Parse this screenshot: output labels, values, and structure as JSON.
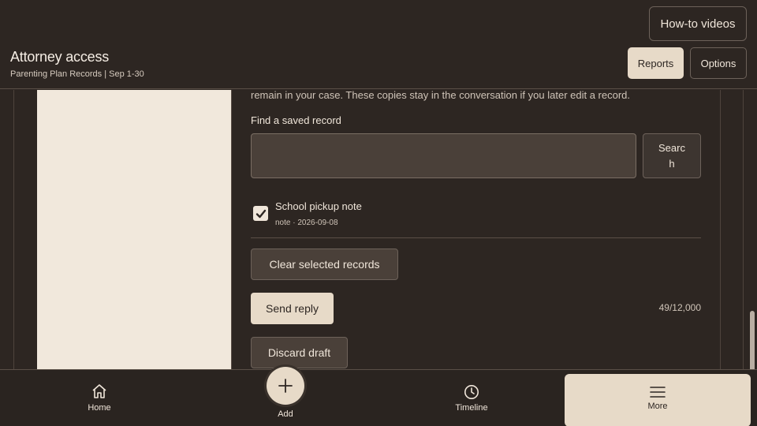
{
  "header": {
    "title": "Attorney access",
    "subtitle": "Parenting Plan Records | Sep 1-30",
    "how_to_label": "How-to videos",
    "reports_label": "Reports",
    "options_label": "Options"
  },
  "main": {
    "intro_text": "remain in your case. These copies stay in the conversation if you later edit a record.",
    "find_label": "Find a saved record",
    "search_value": "",
    "search_placeholder": "",
    "search_button": "Search",
    "record": {
      "title": "School pickup note",
      "meta": "note · 2026-09-08",
      "checked": true
    },
    "clear_button": "Clear selected records",
    "send_button": "Send reply",
    "char_count": "49/12,000",
    "discard_button": "Discard draft"
  },
  "nav": {
    "home": "Home",
    "add": "Add",
    "timeline": "Timeline",
    "more": "More"
  },
  "colors": {
    "background": "#2d2622",
    "accent": "#e7dac8",
    "panel": "#f1e8dc"
  },
  "icons": {
    "home": "home-icon",
    "add": "plus-icon",
    "timeline": "clock-icon",
    "more": "menu-icon",
    "check": "check-icon"
  }
}
